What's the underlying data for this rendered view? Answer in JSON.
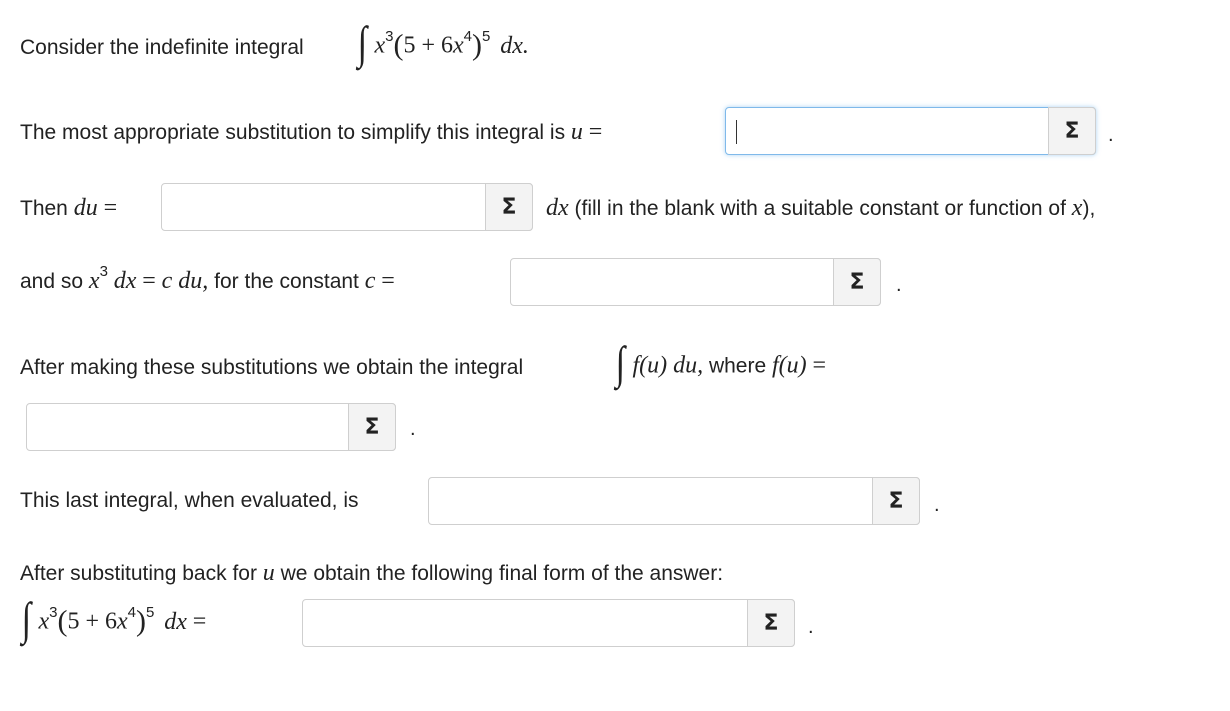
{
  "q1": {
    "prefix": "Consider the indefinite integral",
    "int_sign": "∫",
    "x": "x",
    "exp3": "3",
    "inner": "5 + 6",
    "exp4": "4",
    "exp5": "5",
    "dx": "dx."
  },
  "q2": {
    "text": "The most appropriate substitution to simplify this integral is",
    "var": "u",
    "eq": "=",
    "input_value": ""
  },
  "q3": {
    "prefix": "Then",
    "du": "du",
    "eq": "=",
    "input_value": "",
    "dx": "dx",
    "suffix_a": "(fill in the blank with a suitable constant or function of",
    "xvar": "x",
    "suffix_b": "),"
  },
  "q4": {
    "prefix": "and so",
    "x": "x",
    "exp3": "3",
    "dx": "dx",
    "eq": "=",
    "cdu": "c du,",
    "mid": "for the constant",
    "c": "c",
    "eq2": "=",
    "input_value": ""
  },
  "q5": {
    "prefix": "After making these substitutions we obtain the integral",
    "int_sign": "∫",
    "fu": "f(u) du,",
    "mid": "where",
    "fu2": "f(u)",
    "eq": "=",
    "input_value": ""
  },
  "q6": {
    "text": "This last integral, when evaluated, is",
    "input_value": ""
  },
  "q7": {
    "text_a": "After substituting back for",
    "var": "u",
    "text_b": "we obtain the following final form of the answer:"
  },
  "q8": {
    "int_sign": "∫",
    "x": "x",
    "exp3": "3",
    "inner": "5 + 6",
    "exp4": "4",
    "exp5": "5",
    "dx": "dx",
    "eq": "=",
    "input_value": ""
  },
  "sigma_icon": "Σ",
  "period": "."
}
